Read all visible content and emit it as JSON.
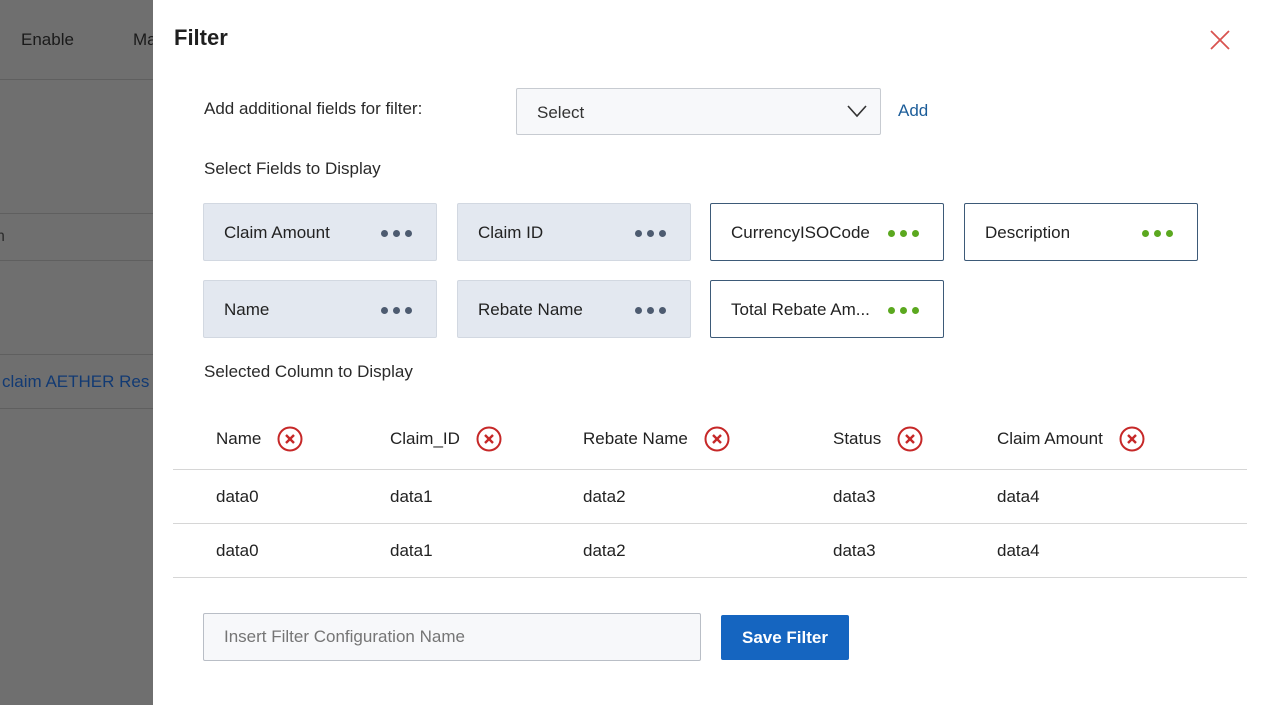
{
  "background": {
    "tabs": [
      "Enable",
      "Ma"
    ],
    "band_text": "n",
    "row_link": "claim AETHER Res"
  },
  "modal": {
    "title": "Filter",
    "close_icon": "close-icon",
    "add_fields_label": "Add additional fields for filter:",
    "select": {
      "value": "Select"
    },
    "add_label": "Add",
    "select_fields_label": "Select Fields to Display",
    "fields": [
      {
        "label": "Claim Amount",
        "selected": false
      },
      {
        "label": "Claim ID",
        "selected": false
      },
      {
        "label": "CurrencyISOCode",
        "selected": true
      },
      {
        "label": "Description",
        "selected": true
      },
      {
        "label": "Name",
        "selected": false
      },
      {
        "label": "Rebate Name",
        "selected": false
      },
      {
        "label": "Total Rebate Am...",
        "selected": true
      }
    ],
    "selected_columns_label": "Selected Column to Display",
    "table": {
      "columns": [
        "Name",
        "Claim_ID",
        "Rebate Name",
        "Status",
        "Claim Amount"
      ],
      "rows": [
        [
          "data0",
          "data1",
          "data2",
          "data3",
          "data4"
        ],
        [
          "data0",
          "data1",
          "data2",
          "data3",
          "data4"
        ]
      ]
    },
    "config_input": {
      "placeholder": "Insert Filter Configuration Name",
      "value": ""
    },
    "save_label": "Save Filter"
  },
  "colors": {
    "accent": "#1565c0",
    "link": "#1c5d99",
    "remove_icon": "#c62828",
    "selected_dots": "#5ba81f",
    "unselected_dots": "#4d5b70"
  }
}
